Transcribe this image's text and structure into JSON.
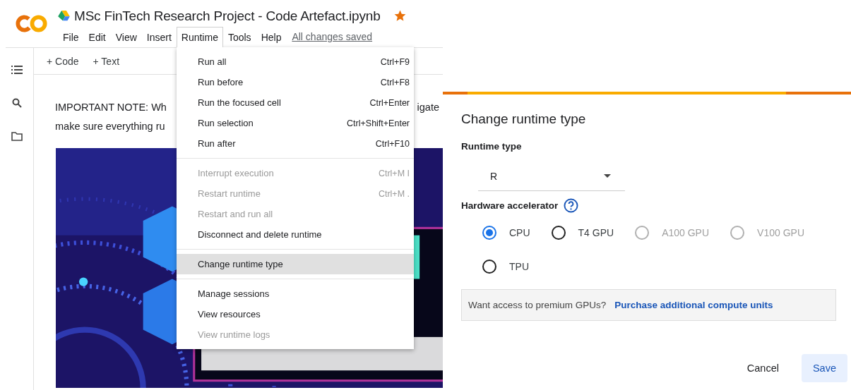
{
  "notebook": {
    "title": "MSc FinTech Research Project - Code Artefact.ipynb",
    "starred": true,
    "menu_bar": [
      {
        "label": "File",
        "selected": false
      },
      {
        "label": "Edit",
        "selected": false
      },
      {
        "label": "View",
        "selected": false
      },
      {
        "label": "Insert",
        "selected": false
      },
      {
        "label": "Runtime",
        "selected": true
      },
      {
        "label": "Tools",
        "selected": false
      },
      {
        "label": "Help",
        "selected": false
      }
    ],
    "save_status": "All changes saved",
    "toolbar": [
      "+ Code",
      "+ Text"
    ],
    "note_lines": [
      {
        "parts": [
          "IMPORTANT NOTE: Wh",
          "igate"
        ]
      },
      {
        "parts": [
          "make sure everything ru"
        ]
      }
    ],
    "cover_image": {
      "kind": "picture"
    }
  },
  "runtime_menu": {
    "groups": [
      {
        "items": [
          {
            "label": "Run all",
            "shortcut": "Ctrl+F9",
            "disabled": false,
            "selected": false
          },
          {
            "label": "Run before",
            "shortcut": "Ctrl+F8",
            "disabled": false,
            "selected": false
          },
          {
            "label": "Run the focused cell",
            "shortcut": "Ctrl+Enter",
            "disabled": false,
            "selected": false
          },
          {
            "label": "Run selection",
            "shortcut": "Ctrl+Shift+Enter",
            "disabled": false,
            "selected": false
          },
          {
            "label": "Run after",
            "shortcut": "Ctrl+F10",
            "disabled": false,
            "selected": false
          }
        ]
      },
      {
        "items": [
          {
            "label": "Interrupt execution",
            "shortcut": "Ctrl+M I",
            "disabled": true,
            "selected": false
          },
          {
            "label": "Restart runtime",
            "shortcut": "Ctrl+M .",
            "disabled": true,
            "selected": false
          },
          {
            "label": "Restart and run all",
            "disabled": true,
            "selected": false
          },
          {
            "label": "Disconnect and delete runtime",
            "disabled": false,
            "selected": false
          }
        ]
      },
      {
        "items": [
          {
            "label": "Change runtime type",
            "disabled": false,
            "selected": true
          }
        ]
      },
      {
        "items": [
          {
            "label": "Manage sessions",
            "disabled": false,
            "selected": false
          },
          {
            "label": "View resources",
            "disabled": false,
            "selected": false
          },
          {
            "label": "View runtime logs",
            "disabled": true,
            "selected": false
          }
        ]
      }
    ]
  },
  "dialog": {
    "title": "Change runtime type",
    "runtime_type_label": "Runtime type",
    "runtime_type_value": "R",
    "accelerator_label": "Hardware accelerator",
    "accelerators": [
      {
        "label": "CPU",
        "selected": true,
        "disabled": false
      },
      {
        "label": "T4 GPU",
        "selected": false,
        "disabled": false
      },
      {
        "label": "A100 GPU",
        "selected": false,
        "disabled": true
      },
      {
        "label": "V100 GPU",
        "selected": false,
        "disabled": true
      },
      {
        "label": "TPU",
        "selected": false,
        "disabled": false
      }
    ],
    "info_text": "Want access to premium GPUs?",
    "info_link": "Purchase additional compute units",
    "buttons": [
      {
        "label": "Cancel",
        "kind": "text"
      },
      {
        "label": "Save",
        "kind": "filled"
      }
    ]
  }
}
